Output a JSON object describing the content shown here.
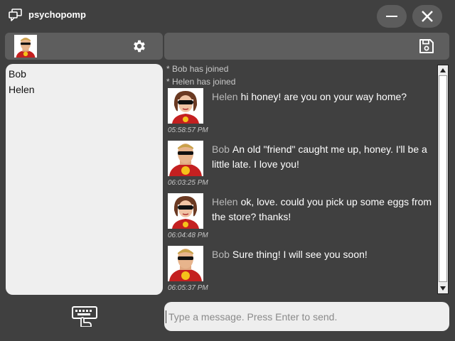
{
  "app": {
    "title": "psychopomp"
  },
  "colors": {
    "background": "#404040",
    "panel": "#5e5e5e",
    "list_bg": "#efefef",
    "name_text": "#b8b8b8"
  },
  "icons": {
    "app": "chat-bubbles-icon",
    "minimize": "minimize-icon",
    "close": "close-icon",
    "settings": "gear-icon",
    "save": "floppy-disk-icon",
    "keyboard": "keyboard-hand-icon"
  },
  "users": [
    "Bob",
    "Helen"
  ],
  "system_messages": [
    "* Bob has joined",
    "* Helen has joined"
  ],
  "messages": [
    {
      "avatar": "helen",
      "sender": "Helen",
      "text": "hi honey! are you on your way home?",
      "time": "05:58:57 PM"
    },
    {
      "avatar": "bob",
      "sender": "Bob",
      "text": "An old \"friend\" caught me up, honey. I'll be a little late. I love you!",
      "time": "06:03:25 PM"
    },
    {
      "avatar": "helen",
      "sender": "Helen",
      "text": "ok, love. could you pick up some eggs from the store? thanks!",
      "time": "06:04:48 PM"
    },
    {
      "avatar": "bob",
      "sender": "Bob",
      "text": "Sure thing! I will see you soon!",
      "time": "06:05:37 PM"
    }
  ],
  "input": {
    "placeholder": "Type a message. Press Enter to send.",
    "value": ""
  }
}
